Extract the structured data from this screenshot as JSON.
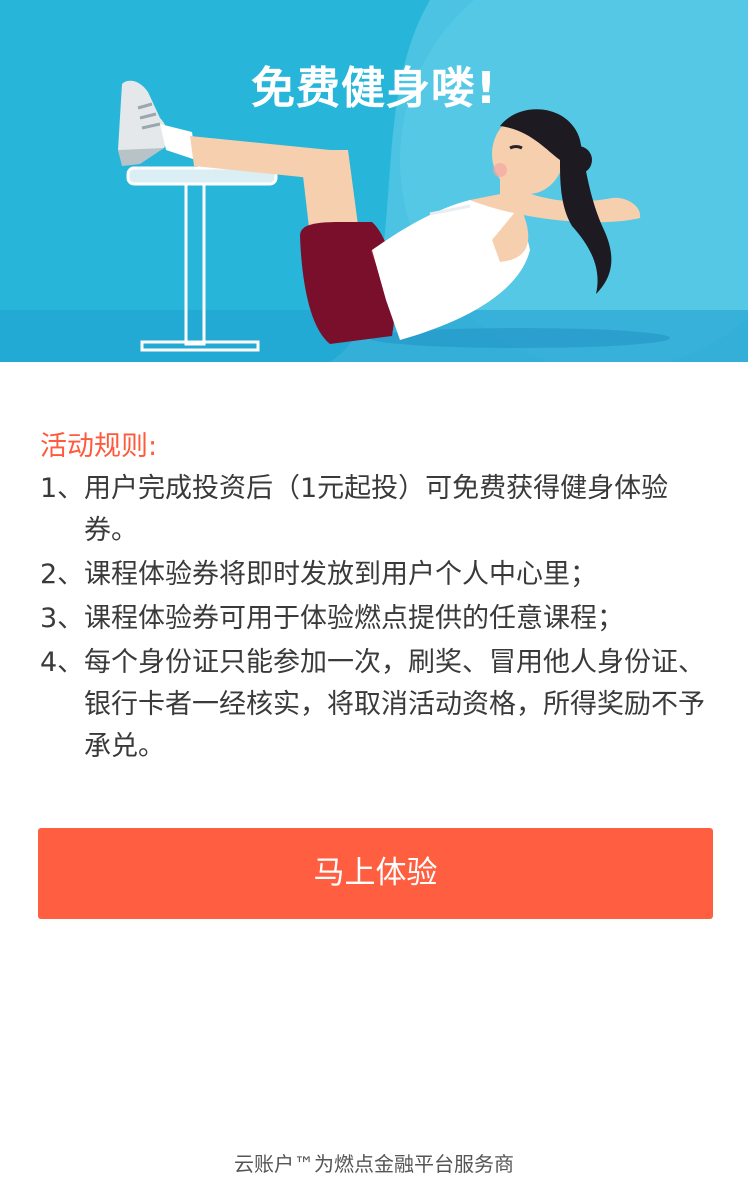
{
  "banner": {
    "title": "免费健身喽!",
    "background_color": "#27b6d9",
    "illustration": "woman-doing-sit-ups-illustration"
  },
  "rules": {
    "title": "活动规则:",
    "title_color": "#ff5a3c",
    "items": [
      {
        "num": "1、",
        "text": "用户完成投资后（1元起投）可免费获得健身体验券。"
      },
      {
        "num": "2、",
        "text": "课程体验券将即时发放到用户个人中心里；"
      },
      {
        "num": "3、",
        "text": "课程体验券可用于体验燃点提供的任意课程；"
      },
      {
        "num": "4、",
        "text": "每个身份证只能参加一次，刷奖、冒用他人身份证、银行卡者一经核实，将取消活动资格，所得奖励不予承兑。"
      }
    ]
  },
  "cta": {
    "label": "马上体验",
    "color": "#ff5f40"
  },
  "footer": {
    "text": "云账户™为燃点金融平台服务商"
  }
}
